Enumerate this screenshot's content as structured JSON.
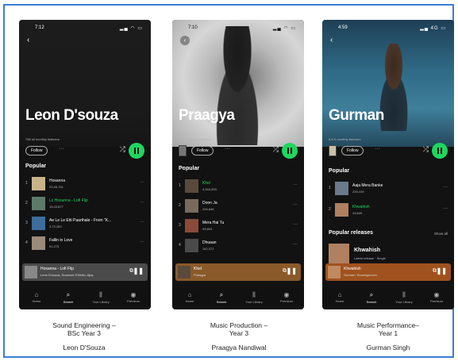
{
  "phones": [
    {
      "time": "7:12",
      "artist": "Leon D'souza",
      "listeners": "758 all monthly listeners",
      "follow": "Follow",
      "popular": "Popular",
      "tracks": [
        {
          "n": "1",
          "title": "Hosanna",
          "plays": "93,45,761",
          "green": false
        },
        {
          "n": "2",
          "title": "Lc Hosanna - Lofi Flip",
          "plays": "15,43,877",
          "green": true
        },
        {
          "n": "3",
          "title": "Ae Le Le Etti Paarthale - From \"K...",
          "plays": "3,73,283",
          "green": false
        },
        {
          "n": "4",
          "title": "Fallin in Love",
          "plays": "91,275",
          "green": false
        }
      ],
      "mini": {
        "title": "Hosanna - Lofi Flip",
        "sub": "Leon D'souza, Susanne D'Mello, Ajay"
      }
    },
    {
      "time": "7:10",
      "artist": "Praagya",
      "listeners": "367K monthly listeners",
      "follow": "Follow",
      "popular": "Popular",
      "tracks": [
        {
          "n": "1",
          "title": "Khel",
          "plays": "4,344,993",
          "green": true
        },
        {
          "n": "2",
          "title": "Doon Ja",
          "plays": "206,846",
          "green": false
        },
        {
          "n": "3",
          "title": "Mera Hai Tu",
          "plays": "99,803",
          "green": false
        },
        {
          "n": "4",
          "title": "Dhuaan",
          "plays": "162,372",
          "green": false
        }
      ],
      "mini": {
        "title": "Khel",
        "sub": "Praagya"
      }
    },
    {
      "time": "4:59",
      "artist": "Gurman",
      "listeners": "6.8 K monthly listeners",
      "follow": "Follow",
      "popular": "Popular",
      "tracks": [
        {
          "n": "1",
          "title": "Aaja Mera Banke",
          "plays": "239,109",
          "green": false
        },
        {
          "n": "2",
          "title": "Khwahish",
          "plays": "43,649",
          "green": true
        }
      ],
      "releases_label": "Popular releases",
      "show_all": "Show all",
      "release": {
        "title": "Khwahish",
        "sub": "Latest release · Single"
      },
      "mini": {
        "title": "Khwahish",
        "sub": "Gurman, Roundgroover"
      }
    }
  ],
  "nav": [
    "Home",
    "Search",
    "Your Library",
    "Premium"
  ],
  "captions": [
    {
      "course": "Sound Engineering –\nBSc Year 3",
      "name": "Leon D'Souza"
    },
    {
      "course": "Music Production –\nYear 3",
      "name": "Praagya Nandiwal"
    },
    {
      "course": "Music Performance–\nYear 1",
      "name": "Gurman Singh"
    }
  ],
  "colors": {
    "accent": "#1ed760",
    "frame": "#3b7dd8",
    "background": "#121212"
  }
}
